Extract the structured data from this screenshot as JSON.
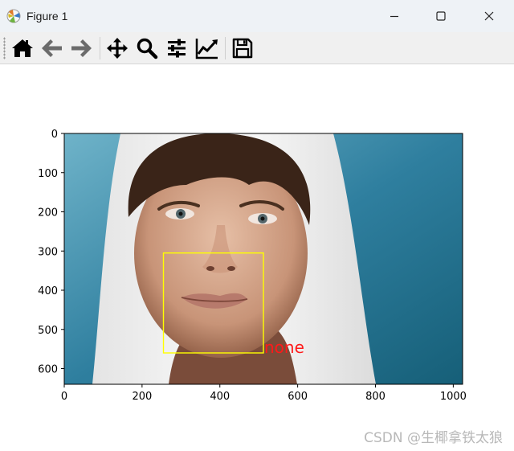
{
  "window": {
    "title": "Figure 1",
    "icon": "matplotlib-icon",
    "controls": [
      "minimize-icon",
      "maximize-icon",
      "close-icon"
    ]
  },
  "toolbar": {
    "buttons": [
      "home-icon",
      "back-icon",
      "forward-icon",
      "pan-icon",
      "zoom-icon",
      "configure-subplots-icon",
      "edit-axes-icon",
      "save-icon"
    ]
  },
  "figure": {
    "image_description_icon": "photo-of-woman-in-white-hood",
    "x_ticks": [
      {
        "value": 0,
        "label": "0"
      },
      {
        "value": 200,
        "label": "200"
      },
      {
        "value": 400,
        "label": "400"
      },
      {
        "value": 600,
        "label": "600"
      },
      {
        "value": 800,
        "label": "800"
      },
      {
        "value": 1000,
        "label": "1000"
      }
    ],
    "y_ticks": [
      {
        "value": 0,
        "label": "0"
      },
      {
        "value": 100,
        "label": "100"
      },
      {
        "value": 200,
        "label": "200"
      },
      {
        "value": 300,
        "label": "300"
      },
      {
        "value": 400,
        "label": "400"
      },
      {
        "value": 500,
        "label": "500"
      },
      {
        "value": 600,
        "label": "600"
      }
    ],
    "x_range": [
      0,
      1024
    ],
    "y_range": [
      0,
      640
    ],
    "detection_box": {
      "x1": 255,
      "y1": 305,
      "x2": 512,
      "y2": 560,
      "color": "#ffff00"
    },
    "detection_label": {
      "text": "none",
      "color": "#ff1a1a"
    }
  },
  "watermark": "CSDN @生椰拿铁太狼"
}
